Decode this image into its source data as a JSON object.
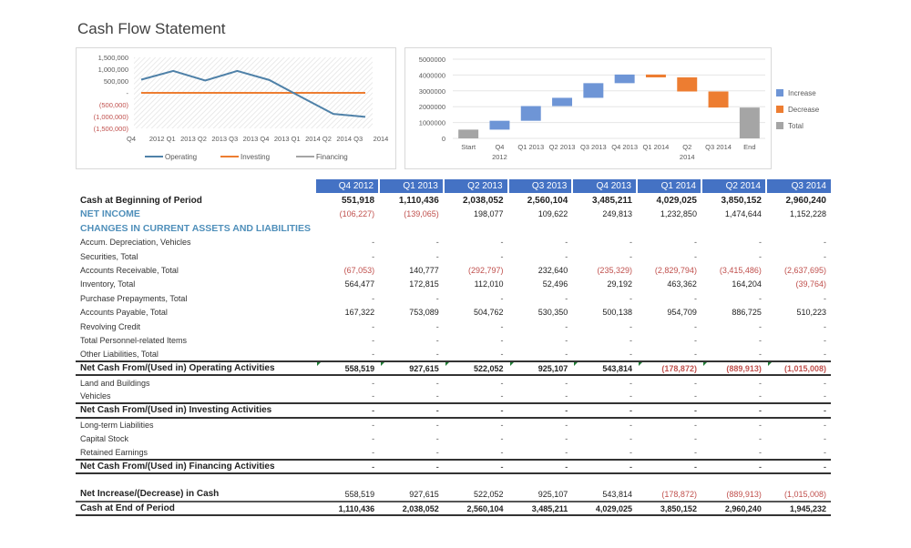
{
  "page": {
    "title": "Cash Flow Statement"
  },
  "chart_data": [
    {
      "type": "line",
      "title": "",
      "categories": [
        "Q4 2012",
        "Q1 2013",
        "Q2 2013",
        "Q3 2013",
        "Q4 2013",
        "Q1 2014",
        "Q2 2014",
        "Q3 2014"
      ],
      "ylim": [
        -1500000,
        1500000
      ],
      "yticks": [
        1500000,
        1000000,
        500000,
        0,
        -500000,
        -1000000,
        -1500000
      ],
      "ytick_labels": [
        "1,500,000",
        "1,000,000",
        "500,000",
        "-",
        "(500,000)",
        "(1,000,000)",
        "(1,500,000)"
      ],
      "xtick_labels": [
        "Q4",
        "2012 Q1",
        "2013 Q2",
        "2013 Q3",
        "2013 Q4",
        "2013 Q1",
        "2014 Q2",
        "2014 Q3",
        "2014"
      ],
      "series": [
        {
          "name": "Operating",
          "color": "#4f81a8",
          "values": [
            558519,
            927615,
            522052,
            925107,
            543814,
            -178872,
            -889913,
            -1015008
          ]
        },
        {
          "name": "Investing",
          "color": "#ed7d31",
          "values": [
            0,
            0,
            0,
            0,
            0,
            0,
            0,
            0
          ]
        },
        {
          "name": "Financing",
          "color": "#a5a5a5",
          "values": [
            0,
            0,
            0,
            0,
            0,
            0,
            0,
            0
          ]
        }
      ],
      "legend": "bottom",
      "grid": false
    },
    {
      "type": "bar",
      "subtype": "waterfall",
      "title": "",
      "categories": [
        "Start",
        "Q4 2012",
        "Q1 2013",
        "Q2 2013",
        "Q3 2013",
        "Q4 2013",
        "Q1 2014",
        "Q2 2014",
        "Q3 2014",
        "End"
      ],
      "xtick_labels": [
        [
          "Start"
        ],
        [
          "Q4",
          "2012"
        ],
        [
          "Q1 2013"
        ],
        [
          "Q2 2013"
        ],
        [
          "Q3 2013"
        ],
        [
          "Q4 2013"
        ],
        [
          "Q1 2014"
        ],
        [
          "Q2",
          "2014"
        ],
        [
          "Q3 2014"
        ],
        [
          "End"
        ]
      ],
      "ylim": [
        0,
        5000000
      ],
      "yticks": [
        0,
        1000000,
        2000000,
        3000000,
        4000000,
        5000000
      ],
      "ytick_labels": [
        "0",
        "1000000",
        "2000000",
        "3000000",
        "4000000",
        "5000000"
      ],
      "bars": [
        {
          "kind": "total",
          "start": 0,
          "end": 551918
        },
        {
          "kind": "increase",
          "start": 551918,
          "end": 1110436
        },
        {
          "kind": "increase",
          "start": 1110436,
          "end": 2038052
        },
        {
          "kind": "increase",
          "start": 2038052,
          "end": 2560104
        },
        {
          "kind": "increase",
          "start": 2560104,
          "end": 3485211
        },
        {
          "kind": "increase",
          "start": 3485211,
          "end": 4029025
        },
        {
          "kind": "decrease",
          "start": 4029025,
          "end": 3850152
        },
        {
          "kind": "decrease",
          "start": 3850152,
          "end": 2960240
        },
        {
          "kind": "decrease",
          "start": 2960240,
          "end": 1945232
        },
        {
          "kind": "total",
          "start": 0,
          "end": 1945232
        }
      ],
      "legend": [
        {
          "name": "Increase",
          "color": "#6e95d6"
        },
        {
          "name": "Decrease",
          "color": "#ed7d31"
        },
        {
          "name": "Total",
          "color": "#a5a5a5"
        }
      ],
      "legend_position": "right",
      "grid": true
    }
  ],
  "table": {
    "columns": [
      "Q4 2012",
      "Q1 2013",
      "Q2 2013",
      "Q3 2013",
      "Q4 2013",
      "Q1 2014",
      "Q2 2014",
      "Q3 2014"
    ],
    "rows": [
      {
        "style": "bold",
        "label": "Cash at Beginning of Period",
        "values": [
          "551,918",
          "1,110,436",
          "2,038,052",
          "2,560,104",
          "3,485,211",
          "4,029,025",
          "3,850,152",
          "2,960,240"
        ]
      },
      {
        "style": "blue",
        "label": "NET INCOME",
        "values": [
          "(106,227)",
          "(139,065)",
          "198,077",
          "109,622",
          "249,813",
          "1,232,850",
          "1,474,644",
          "1,152,228"
        ]
      },
      {
        "style": "blue",
        "label": "CHANGES IN CURRENT ASSETS AND LIABILITIES",
        "values": [
          "",
          "",
          "",
          "",
          "",
          "",
          "",
          ""
        ]
      },
      {
        "style": "sub",
        "label": "Accum. Depreciation, Vehicles",
        "values": [
          "-",
          "-",
          "-",
          "-",
          "-",
          "-",
          "-",
          "-"
        ]
      },
      {
        "style": "sub",
        "label": "Securities, Total",
        "values": [
          "-",
          "-",
          "-",
          "-",
          "-",
          "-",
          "-",
          "-"
        ]
      },
      {
        "style": "sub",
        "label": "Accounts Receivable, Total",
        "values": [
          "(67,053)",
          "140,777",
          "(292,797)",
          "232,640",
          "(235,329)",
          "(2,829,794)",
          "(3,415,486)",
          "(2,637,695)"
        ]
      },
      {
        "style": "sub",
        "label": "Inventory, Total",
        "values": [
          "564,477",
          "172,815",
          "112,010",
          "52,496",
          "29,192",
          "463,362",
          "164,204",
          "(39,764)"
        ]
      },
      {
        "style": "sub",
        "label": "Purchase Prepayments, Total",
        "values": [
          "-",
          "-",
          "-",
          "-",
          "-",
          "-",
          "-",
          "-"
        ]
      },
      {
        "style": "sub",
        "label": "Accounts Payable, Total",
        "values": [
          "167,322",
          "753,089",
          "504,762",
          "530,350",
          "500,138",
          "954,709",
          "886,725",
          "510,223"
        ]
      },
      {
        "style": "sub",
        "label": "Revolving Credit",
        "values": [
          "-",
          "-",
          "-",
          "-",
          "-",
          "-",
          "-",
          "-"
        ]
      },
      {
        "style": "sub",
        "label": "Total Personnel-related Items",
        "values": [
          "-",
          "-",
          "-",
          "-",
          "-",
          "-",
          "-",
          "-"
        ]
      },
      {
        "style": "sub",
        "label": "Other Liabilities, Total",
        "values": [
          "-",
          "-",
          "-",
          "-",
          "-",
          "-",
          "-",
          "-"
        ]
      },
      {
        "style": "total",
        "label": "Net Cash From/(Used in) Operating Activities",
        "values": [
          "558,519",
          "927,615",
          "522,052",
          "925,107",
          "543,814",
          "(178,872)",
          "(889,913)",
          "(1,015,008)"
        ]
      },
      {
        "style": "sub",
        "label": "Land and Buildings",
        "values": [
          "-",
          "-",
          "-",
          "-",
          "-",
          "-",
          "-",
          "-"
        ]
      },
      {
        "style": "sub",
        "label": "Vehicles",
        "values": [
          "-",
          "-",
          "-",
          "-",
          "-",
          "-",
          "-",
          "-"
        ]
      },
      {
        "style": "total",
        "label": "Net Cash From/(Used in) Investing Activities",
        "values": [
          "-",
          "-",
          "-",
          "-",
          "-",
          "-",
          "-",
          "-"
        ]
      },
      {
        "style": "sub",
        "label": "Long-term Liabilities",
        "values": [
          "-",
          "-",
          "-",
          "-",
          "-",
          "-",
          "-",
          "-"
        ]
      },
      {
        "style": "sub",
        "label": "Capital Stock",
        "values": [
          "-",
          "-",
          "-",
          "-",
          "-",
          "-",
          "-",
          "-"
        ]
      },
      {
        "style": "sub",
        "label": "Retained Earnings",
        "values": [
          "-",
          "-",
          "-",
          "-",
          "-",
          "-",
          "-",
          "-"
        ]
      },
      {
        "style": "total",
        "label": "Net Cash From/(Used in) Financing Activities",
        "values": [
          "-",
          "-",
          "-",
          "-",
          "-",
          "-",
          "-",
          "-"
        ]
      },
      {
        "style": "spacer",
        "label": "",
        "values": [
          "",
          "",
          "",
          "",
          "",
          "",
          "",
          ""
        ]
      },
      {
        "style": "netinc",
        "label": "Net Increase/(Decrease) in Cash",
        "values": [
          "558,519",
          "927,615",
          "522,052",
          "925,107",
          "543,814",
          "(178,872)",
          "(889,913)",
          "(1,015,008)"
        ]
      },
      {
        "style": "end",
        "label": "Cash at End of Period",
        "values": [
          "1,110,436",
          "2,038,052",
          "2,560,104",
          "3,485,211",
          "4,029,025",
          "3,850,152",
          "2,960,240",
          "1,945,232"
        ]
      }
    ]
  }
}
